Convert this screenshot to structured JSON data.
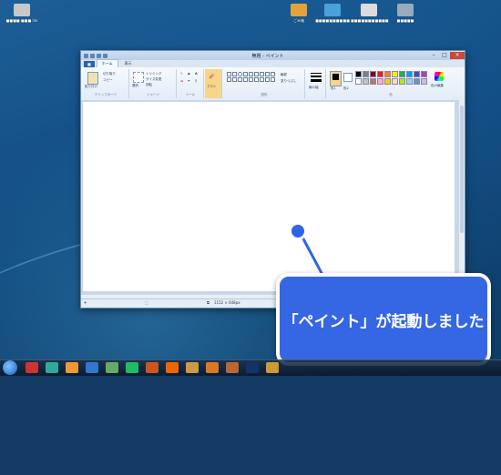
{
  "desktop": {
    "icons": [
      {
        "label": "■■■■ ■■■.lnk",
        "color": "#c8c8c8"
      },
      {
        "label": "ごみ箱",
        "color": "#e4a33a"
      },
      {
        "label": "■■■■■■■■■■",
        "color": "#4aa0d8"
      },
      {
        "label": "■■■■■■■■■■■",
        "color": "#dcdcdc"
      },
      {
        "label": "■■■■■",
        "color": "#9ab"
      }
    ]
  },
  "window": {
    "title": "無題 - ペイント",
    "file_tab": "■",
    "tabs": [
      "ホーム",
      "表示"
    ],
    "groups": {
      "clipboard": {
        "label": "クリップボード",
        "paste": "貼り付け",
        "cut": "切り取り",
        "copy": "コピー"
      },
      "image": {
        "label": "イメージ",
        "select": "選択",
        "crop": "トリミング",
        "resize": "サイズ変更",
        "rotate": "回転"
      },
      "tools": {
        "label": "ツール"
      },
      "brush": {
        "label": "ブラシ"
      },
      "shapes": {
        "label": "図形",
        "outline": "輪郭",
        "fill": "塗りつぶし"
      },
      "size": {
        "label": "線の幅"
      },
      "colors": {
        "label": "色",
        "color1": "色1",
        "color2": "色2",
        "edit": "色の編集"
      }
    },
    "palette": [
      "#000000",
      "#7f7f7f",
      "#880015",
      "#ed1c24",
      "#ff7f27",
      "#fff200",
      "#22b14c",
      "#00a2e8",
      "#3f48cc",
      "#a349a4",
      "#ffffff",
      "#c3c3c3",
      "#b97a57",
      "#ffaec9",
      "#ffc90e",
      "#efe4b0",
      "#b5e61d",
      "#99d9ea",
      "#7092be",
      "#c8bfe7"
    ],
    "status": {
      "size": "1152 × 648px"
    }
  },
  "callout": {
    "text": "「ペイント」が起動しました",
    "color": "#3566e3"
  }
}
